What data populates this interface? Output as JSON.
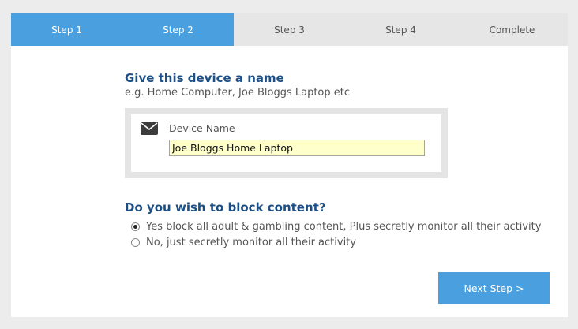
{
  "wizard": {
    "steps": [
      {
        "label": "Step 1",
        "active": true
      },
      {
        "label": "Step 2",
        "active": true
      },
      {
        "label": "Step 3",
        "active": false
      },
      {
        "label": "Step 4",
        "active": false
      },
      {
        "label": "Complete",
        "active": false
      }
    ]
  },
  "device_name_section": {
    "title": "Give this device a name",
    "subtitle": "e.g. Home Computer, Joe Bloggs Laptop etc",
    "field_label": "Device Name",
    "field_value": "Joe Bloggs Home Laptop",
    "icon": "envelope-icon"
  },
  "block_content_section": {
    "title": "Do you wish to block content?",
    "options": [
      {
        "label": "Yes block all adult & gambling content, Plus secretly monitor all their activity",
        "selected": true
      },
      {
        "label": "No, just secretly monitor all their activity",
        "selected": false
      }
    ]
  },
  "actions": {
    "next_label": "Next Step >"
  },
  "colors": {
    "accent": "#4aa0de",
    "heading": "#1c4f86",
    "background": "#ececec",
    "input_bg": "#ffffcc"
  }
}
